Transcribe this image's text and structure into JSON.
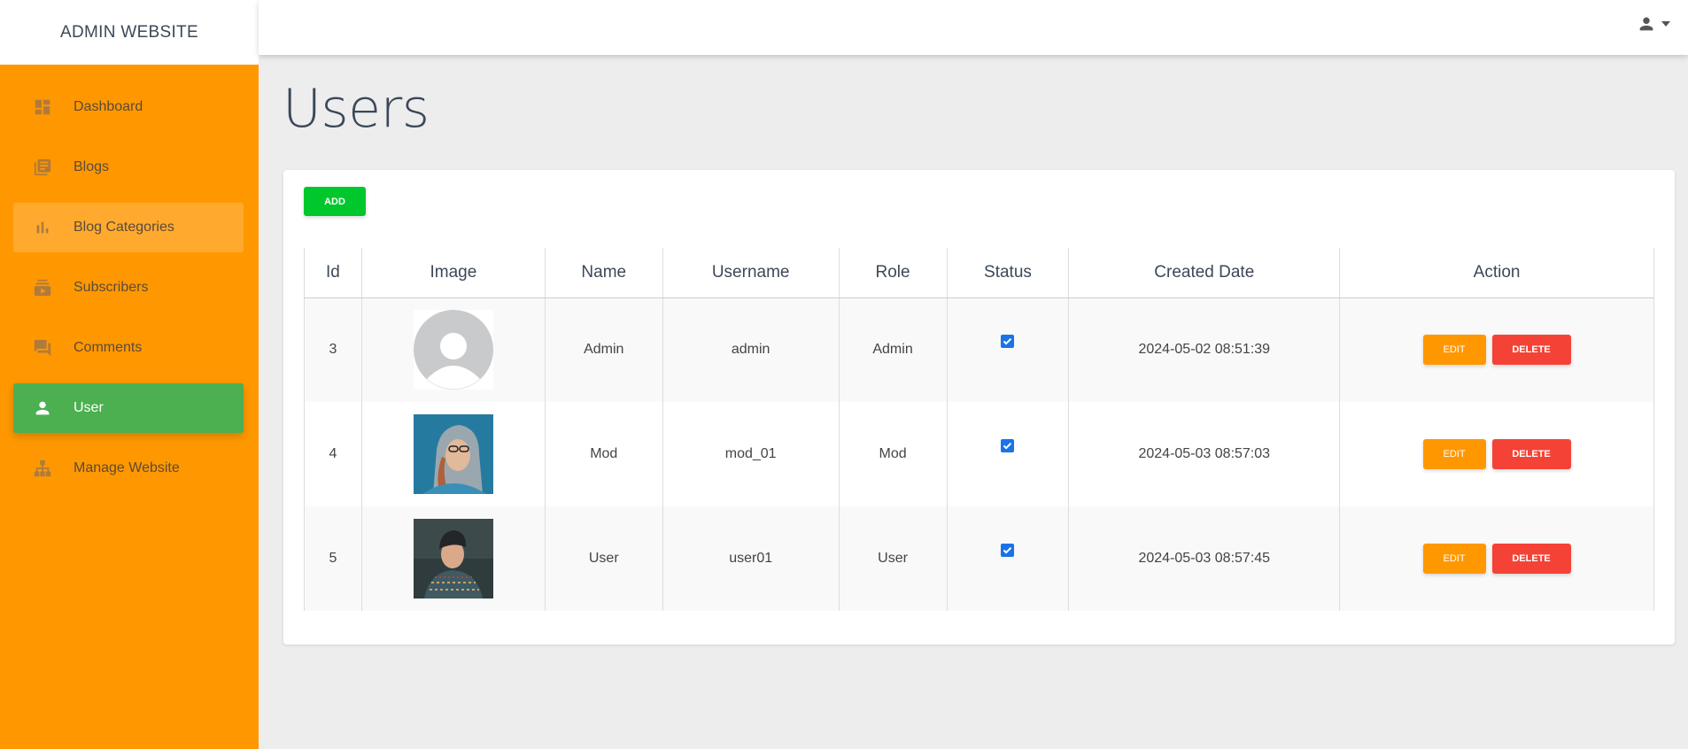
{
  "brand": "ADMIN WEBSITE",
  "sidebar": {
    "items": [
      {
        "label": "Dashboard",
        "icon": "dashboard-icon"
      },
      {
        "label": "Blogs",
        "icon": "blogs-icon"
      },
      {
        "label": "Blog Categories",
        "icon": "bar-chart-icon"
      },
      {
        "label": "Subscribers",
        "icon": "subscribers-icon"
      },
      {
        "label": "Comments",
        "icon": "comments-icon"
      },
      {
        "label": "User",
        "icon": "person-icon"
      },
      {
        "label": "Manage Website",
        "icon": "sitemap-icon"
      }
    ]
  },
  "page": {
    "title": "Users"
  },
  "toolbar": {
    "add_label": "ADD"
  },
  "table": {
    "headers": [
      "Id",
      "Image",
      "Name",
      "Username",
      "Role",
      "Status",
      "Created Date",
      "Action"
    ],
    "rows": [
      {
        "id": "3",
        "image": "default-avatar",
        "name": "Admin",
        "username": "admin",
        "role": "Admin",
        "status": true,
        "created": "2024-05-02 08:51:39"
      },
      {
        "id": "4",
        "image": "woman-hood-photo",
        "name": "Mod",
        "username": "mod_01",
        "role": "Mod",
        "status": true,
        "created": "2024-05-03 08:57:03"
      },
      {
        "id": "5",
        "image": "man-beanie-photo",
        "name": "User",
        "username": "user01",
        "role": "User",
        "status": true,
        "created": "2024-05-03 08:57:45"
      }
    ],
    "edit_label": "EDIT",
    "delete_label": "DELETE"
  },
  "colors": {
    "sidebar": "#ff9800",
    "active_item": "#4caf50",
    "add_button": "#00c72b",
    "edit_button": "#ff9800",
    "delete_button": "#f44336"
  }
}
